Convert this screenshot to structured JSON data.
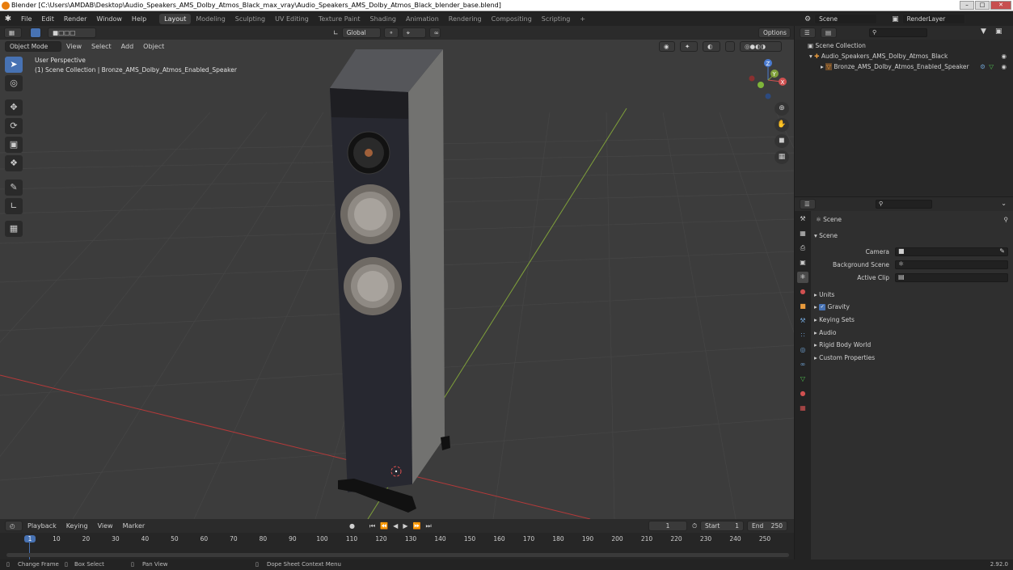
{
  "window": {
    "title": "Blender [C:\\Users\\AMDAB\\Desktop\\Audio_Speakers_AMS_Dolby_Atmos_Black_max_vray\\Audio_Speakers_AMS_Dolby_Atmos_Black_blender_base.blend]"
  },
  "menu": [
    "File",
    "Edit",
    "Render",
    "Window",
    "Help"
  ],
  "workspaces": [
    {
      "label": "Layout",
      "active": true
    },
    {
      "label": "Modeling"
    },
    {
      "label": "Sculpting"
    },
    {
      "label": "UV Editing"
    },
    {
      "label": "Texture Paint"
    },
    {
      "label": "Shading"
    },
    {
      "label": "Animation"
    },
    {
      "label": "Rendering"
    },
    {
      "label": "Compositing"
    },
    {
      "label": "Scripting"
    }
  ],
  "add_workspace": "+",
  "scene_selector": {
    "value": "Scene"
  },
  "render_layer": {
    "value": "RenderLayer"
  },
  "viewport_header": {
    "transform_orientation": "Global",
    "options": "Options",
    "mode": "Object Mode",
    "menus": [
      "View",
      "Select",
      "Add",
      "Object"
    ]
  },
  "viewport": {
    "perspective": "User Perspective",
    "collection_info": "(1) Scene Collection | Bronze_AMS_Dolby_Atmos_Enabled_Speaker"
  },
  "gizmo": {
    "x": "X",
    "y": "Y",
    "z": "Z"
  },
  "outliner": {
    "root": "Scene Collection",
    "items": [
      {
        "label": "Audio_Speakers_AMS_Dolby_Atmos_Black"
      },
      {
        "label": "Bronze_AMS_Dolby_Atmos_Enabled_Speaker"
      }
    ]
  },
  "properties": {
    "breadcrumb": "Scene",
    "panel_title": "Scene",
    "fields": [
      {
        "label": "Camera"
      },
      {
        "label": "Background Scene"
      },
      {
        "label": "Active Clip"
      }
    ],
    "sections": [
      {
        "label": "Units"
      },
      {
        "label": "Gravity",
        "checked": true
      },
      {
        "label": "Keying Sets"
      },
      {
        "label": "Audio"
      },
      {
        "label": "Rigid Body World"
      },
      {
        "label": "Custom Properties"
      }
    ]
  },
  "timeline": {
    "menus": [
      "Playback",
      "Keying",
      "View",
      "Marker"
    ],
    "current_frame": "1",
    "start_label": "Start",
    "start": "1",
    "end_label": "End",
    "end": "250",
    "ticks": [
      "1",
      "10",
      "20",
      "30",
      "40",
      "50",
      "60",
      "70",
      "80",
      "90",
      "100",
      "110",
      "120",
      "130",
      "140",
      "150",
      "160",
      "170",
      "180",
      "190",
      "200",
      "210",
      "220",
      "230",
      "240",
      "250"
    ]
  },
  "status": {
    "hints": [
      "Change Frame",
      "Box Select",
      "Pan View",
      "Dope Sheet Context Menu"
    ],
    "version": "2.92.0"
  },
  "colors": {
    "accent": "#4772b3",
    "x_axis": "#b53a3a",
    "y_axis": "#7fa03a",
    "header": "#2b2b2b",
    "viewport_bg": "#3c3c3c"
  }
}
